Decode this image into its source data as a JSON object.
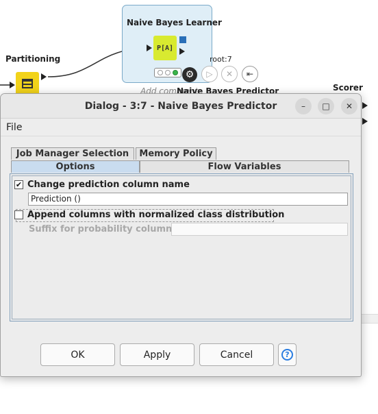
{
  "workflow": {
    "learner_node": {
      "title": "Naive Bayes Learner",
      "icon_label": "P[A]"
    },
    "partitioning_node": {
      "title": "Partitioning"
    },
    "predictor_node": {
      "title": "Naive Bayes Predictor",
      "node_id": "root:7"
    },
    "scorer_node": {
      "title": "Scorer"
    },
    "add_comment": "Add comment"
  },
  "dialog": {
    "title": "Dialog - 3:7 - Naive Bayes Predictor",
    "window_buttons": {
      "minimize": "–",
      "maximize": "□",
      "close": "✕"
    },
    "menu": [
      "File"
    ],
    "tabs": {
      "row1": [
        "Job Manager Selection",
        "Memory Policy"
      ],
      "row2": [
        "Options",
        "Flow Variables"
      ],
      "active": "Options"
    },
    "options": {
      "change_prediction": {
        "label": "Change prediction column name",
        "checked": true
      },
      "prediction_column": "Prediction ()",
      "append_columns": {
        "label": "Append columns with normalized class distribution",
        "checked": false
      },
      "suffix": {
        "label": "Suffix for probability columns",
        "value": ""
      }
    },
    "buttons": {
      "ok": "OK",
      "apply": "Apply",
      "cancel": "Cancel",
      "help": "?"
    }
  },
  "colors": {
    "active_tab": "#c9dcef",
    "learner_node": "#d8ea30",
    "partitioning_node": "#f2d31a",
    "port_blue": "#2a6fb8",
    "status_green": "#3ab54a",
    "help_blue": "#2a7de1"
  },
  "icons": {
    "check": "✔",
    "execute": "▷",
    "cancel": "✕",
    "reset": "⇤",
    "gear": "⚙"
  }
}
